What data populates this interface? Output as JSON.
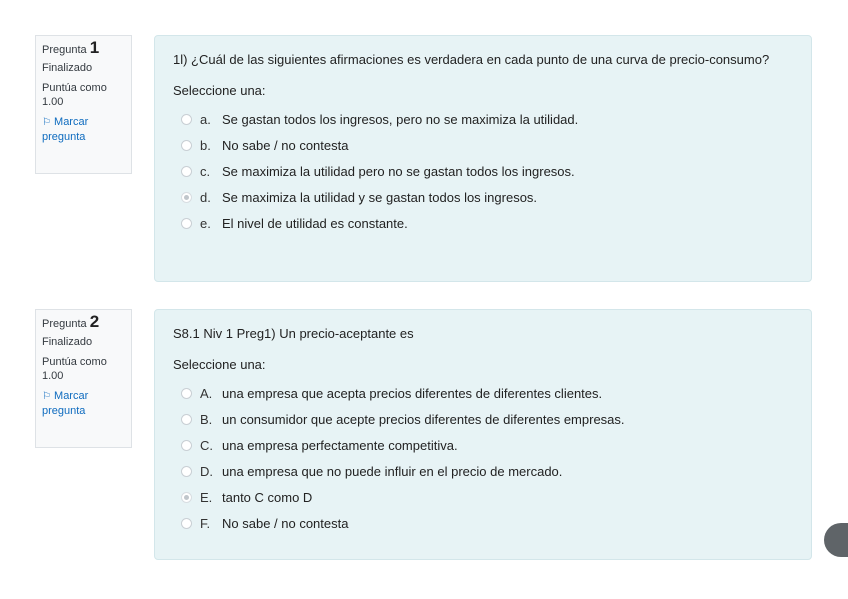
{
  "questions": [
    {
      "info": {
        "label": "Pregunta",
        "number": "1",
        "state": "Finalizado",
        "grade": "Puntúa como 1.00",
        "flag": "Marcar pregunta"
      },
      "text": "1l) ¿Cuál de las siguientes afirmaciones es verdadera en cada punto de una curva de precio-consumo?",
      "prompt": "Seleccione una:",
      "options": [
        {
          "letter": "a.",
          "text": "Se gastan todos los ingresos, pero no se maximiza la utilidad.",
          "selected": false
        },
        {
          "letter": "b.",
          "text": "No sabe / no contesta",
          "selected": false
        },
        {
          "letter": "c.",
          "text": "Se maximiza la utilidad pero no se gastan todos los ingresos.",
          "selected": false
        },
        {
          "letter": "d.",
          "text": "Se maximiza la utilidad y se gastan todos los ingresos.",
          "selected": true
        },
        {
          "letter": "e.",
          "text": "El nivel de utilidad es constante.",
          "selected": false
        }
      ]
    },
    {
      "info": {
        "label": "Pregunta",
        "number": "2",
        "state": "Finalizado",
        "grade": "Puntúa como 1.00",
        "flag": "Marcar pregunta"
      },
      "text": "S8.1 Niv 1 Preg1) Un precio-aceptante  es",
      "prompt": "Seleccione una:",
      "options": [
        {
          "letter": "A.",
          "text": "una empresa que acepta precios diferentes de diferentes clientes.",
          "selected": false
        },
        {
          "letter": "B.",
          "text": "un consumidor que acepte precios diferentes de diferentes empresas.",
          "selected": false
        },
        {
          "letter": "C.",
          "text": "una empresa perfectamente competitiva.",
          "selected": false
        },
        {
          "letter": "D.",
          "text": "una empresa que no puede influir en el precio de mercado.",
          "selected": false
        },
        {
          "letter": "E.",
          "text": "tanto C como D",
          "selected": true
        },
        {
          "letter": "F.",
          "text": "No sabe / no contesta",
          "selected": false
        }
      ]
    }
  ],
  "icons": {
    "flag": "flag-icon",
    "help": "floating-help-icon"
  }
}
